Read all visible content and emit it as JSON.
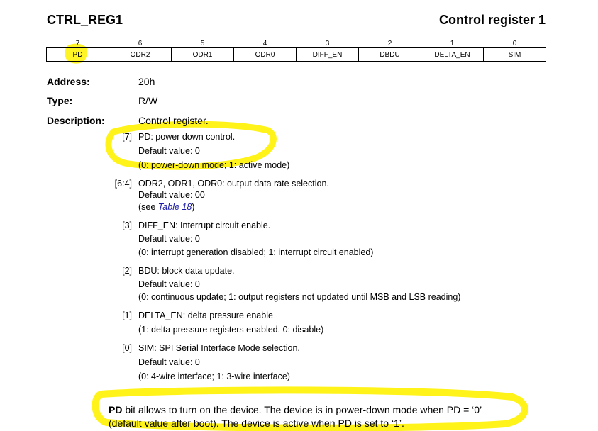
{
  "header": {
    "register_name": "CTRL_REG1",
    "register_title": "Control register 1"
  },
  "bit_table": {
    "bit_numbers": [
      "7",
      "6",
      "5",
      "4",
      "3",
      "2",
      "1",
      "0"
    ],
    "bit_names": [
      "PD",
      "ODR2",
      "ODR1",
      "ODR0",
      "DIFF_EN",
      "DBDU",
      "DELTA_EN",
      "SIM"
    ]
  },
  "fields": {
    "address_label": "Address:",
    "address_value": "20h",
    "type_label": "Type:",
    "type_value": "R/W",
    "description_label": "Description:",
    "description_value": "Control register."
  },
  "bits": [
    {
      "range": "[7]",
      "lines": [
        "PD: power down control.",
        "Default value: 0",
        "(0: power-down mode; 1: active mode)"
      ]
    },
    {
      "range": "[6:4]",
      "lines": [
        "ODR2, ODR1, ODR0: output data rate selection.",
        "Default value: 00"
      ],
      "see_prefix": "(see ",
      "see_link": "Table 18",
      "see_suffix": ")"
    },
    {
      "range": "[3]",
      "lines": [
        "DIFF_EN: Interrupt circuit enable.",
        "Default value: 0",
        "(0: interrupt generation disabled; 1: interrupt circuit enabled)"
      ]
    },
    {
      "range": "[2]",
      "lines": [
        "BDU: block data update.",
        "Default value: 0",
        "(0: continuous update; 1: output registers not updated until MSB and LSB reading)"
      ]
    },
    {
      "range": "[1]",
      "lines": [
        "DELTA_EN: delta pressure enable",
        "(1: delta pressure registers enabled. 0: disable)"
      ]
    },
    {
      "range": "[0]",
      "lines": [
        "SIM: SPI Serial Interface Mode selection.",
        "Default value: 0",
        "(0: 4-wire interface; 1: 3-wire interface)"
      ]
    }
  ],
  "note": {
    "bold": "PD",
    "line1": " bit allows to turn on the device. The device is in power-down mode when PD = ‘0’",
    "line2": "(default value after boot). The device is active when PD is set to ‘1’."
  },
  "colors": {
    "highlight": "#FFF200",
    "link": "#1A1AA6"
  }
}
